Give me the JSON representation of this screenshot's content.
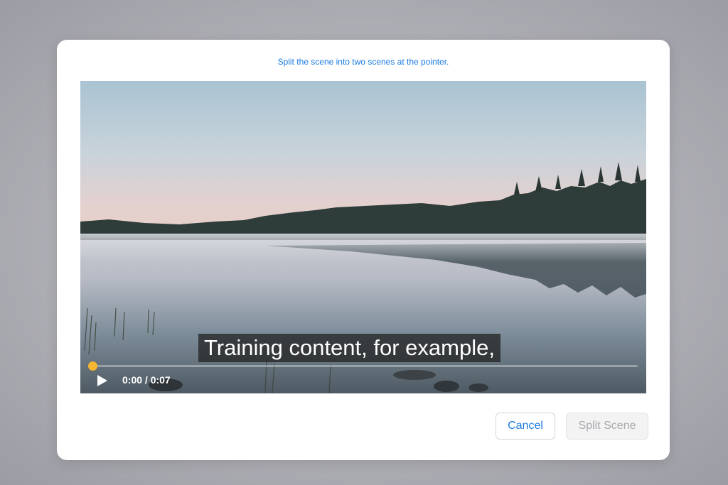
{
  "dialog": {
    "instruction": "Split the scene into two scenes at the pointer.",
    "video": {
      "caption": "Training content, for example,",
      "time_display": "0:00 / 0:07",
      "progress_fraction": 0.0,
      "accent_color": "#f5b731"
    },
    "buttons": {
      "cancel_label": "Cancel",
      "split_label": "Split Scene"
    }
  }
}
